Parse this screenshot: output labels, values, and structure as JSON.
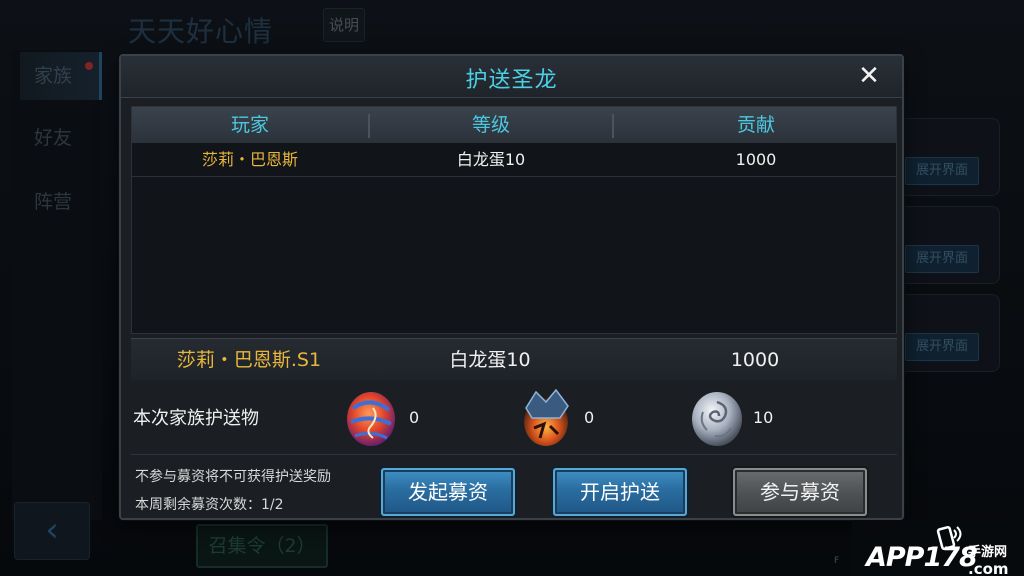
{
  "background": {
    "title": "天天好心情",
    "explain_label": "说明",
    "sidebar": [
      {
        "label": "家族",
        "active": true,
        "has_dot": true
      },
      {
        "label": "好友",
        "active": false
      },
      {
        "label": "阵营",
        "active": false
      }
    ],
    "expand_label": "展开界面",
    "gather_label": "召集令（2）",
    "fps_label": "F"
  },
  "watermark": {
    "brand": "APP178",
    "site": "手游网",
    "domain": ".com"
  },
  "dialog": {
    "title": "护送圣龙",
    "close_icon": "close-x-icon",
    "columns": [
      "玩家",
      "等级",
      "贡献"
    ],
    "rows": [
      {
        "player": "莎莉・巴恩斯",
        "level": "白龙蛋10",
        "contribution": "1000"
      }
    ],
    "self_row": {
      "player": "莎莉・巴恩斯.S1",
      "level": "白龙蛋10",
      "contribution": "1000"
    },
    "protect_label": "本次家族护送物",
    "items": [
      {
        "icon": "red-dragon-egg-icon",
        "count": "0"
      },
      {
        "icon": "lava-dragon-egg-icon",
        "count": "0"
      },
      {
        "icon": "white-dragon-egg-icon",
        "count": "10"
      }
    ],
    "hint": "不参与募资将不可获得护送奖励",
    "remain_label": "本周剩余募资次数：1/2",
    "buttons": {
      "start_fundraise": "发起募资",
      "start_escort": "开启护送",
      "join_fundraise": "参与募资"
    }
  },
  "colors": {
    "title_cyan": "#4cd0e6",
    "name_gold": "#e8b63a",
    "button_blue": "#2a6da0",
    "button_gray": "#505356"
  }
}
